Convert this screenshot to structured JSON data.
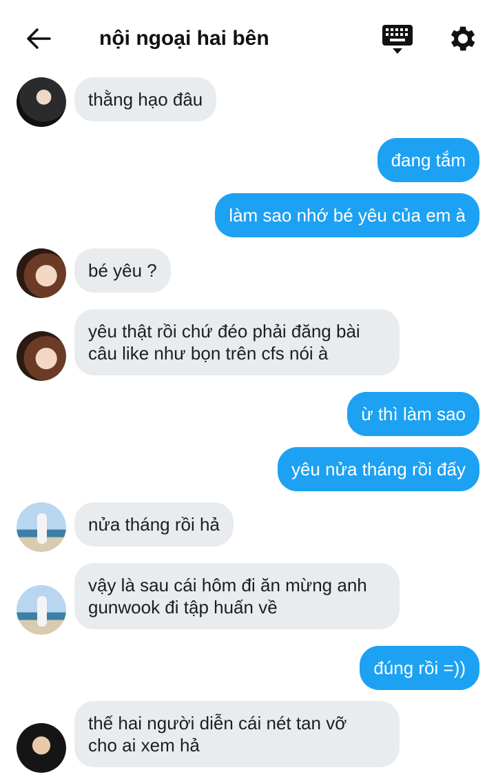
{
  "header": {
    "title": "nội ngoại hai bên",
    "back_icon": "arrow-left-icon",
    "keyboard_icon": "keyboard-icon",
    "settings_icon": "gear-icon"
  },
  "messages": [
    {
      "side": "received",
      "avatar": "avatar-1",
      "text": "thằng hạo đâu"
    },
    {
      "side": "sent",
      "text": "đang tắm"
    },
    {
      "side": "sent",
      "text": "làm sao nhớ bé yêu của em à"
    },
    {
      "side": "received",
      "avatar": "avatar-2",
      "text": "bé yêu ?"
    },
    {
      "side": "received",
      "avatar": "avatar-2",
      "lines": [
        "yêu thật rồi chứ đéo phải đăng bài",
        "câu like như bọn trên cfs nói à"
      ]
    },
    {
      "side": "sent",
      "text": "ừ thì làm sao"
    },
    {
      "side": "sent",
      "text": "yêu nửa tháng rồi đấy"
    },
    {
      "side": "received",
      "avatar": "avatar-3",
      "text": "nửa tháng rồi hả"
    },
    {
      "side": "received",
      "avatar": "avatar-3",
      "lines": [
        "vậy là sau cái hôm đi ăn mừng anh",
        "gunwook đi tập huấn về"
      ]
    },
    {
      "side": "sent",
      "text": "đúng rồi =))"
    },
    {
      "side": "received",
      "avatar": "avatar-4",
      "lines": [
        "thế hai người diễn cái nét tan vỡ",
        "cho ai xem hả"
      ]
    }
  ],
  "colors": {
    "sent_bubble": "#1da1f2",
    "received_bubble": "#e9ecef"
  }
}
